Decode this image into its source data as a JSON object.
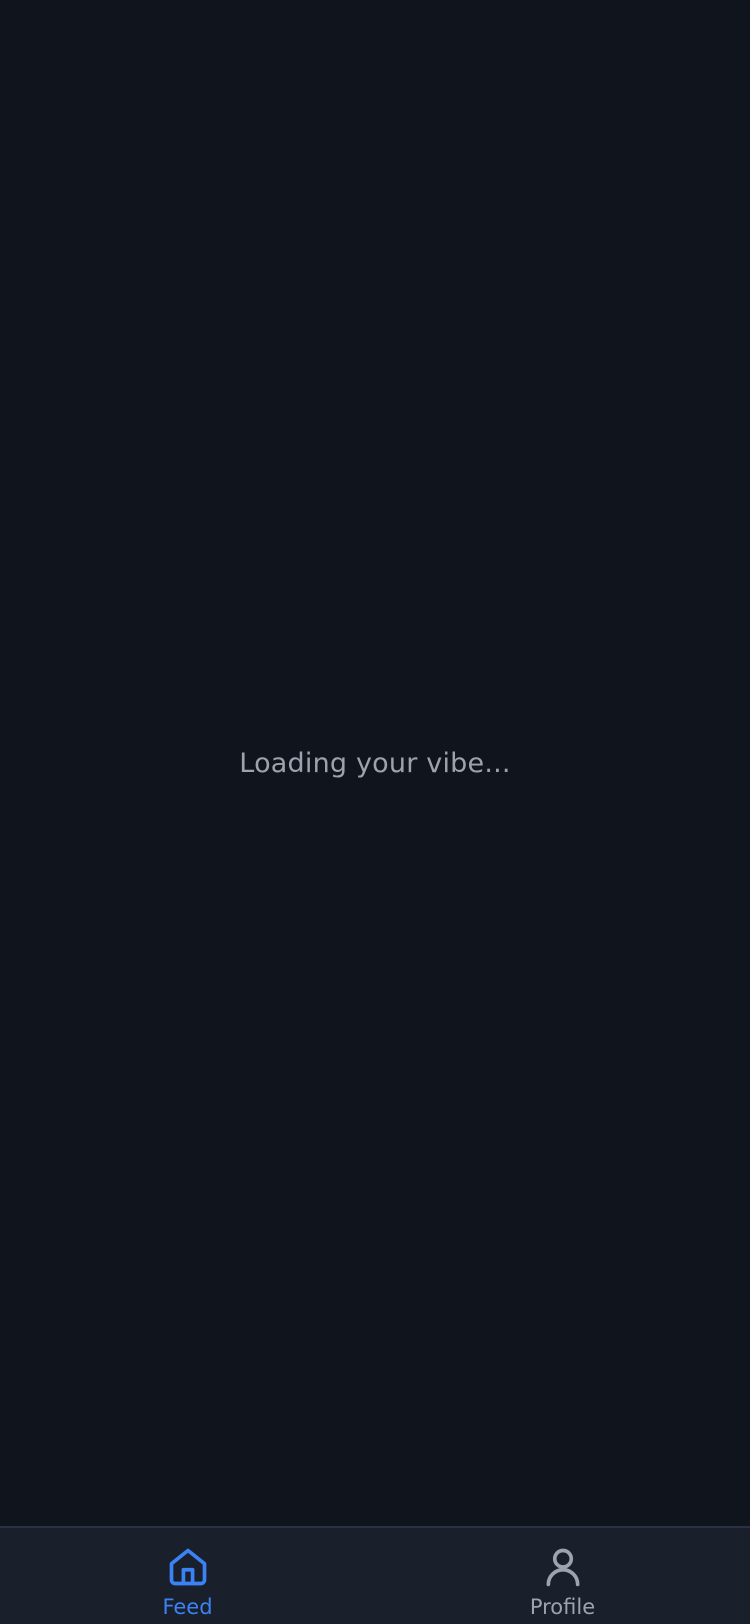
{
  "status": {
    "loading_message": "Loading your vibe..."
  },
  "tabbar": {
    "tabs": [
      {
        "id": "feed",
        "label": "Feed",
        "icon": "home-icon",
        "active": true
      },
      {
        "id": "profile",
        "label": "Profile",
        "icon": "user-icon",
        "active": false
      }
    ]
  },
  "colors": {
    "background": "#10141c",
    "tabbar_background": "#1a202b",
    "accent": "#3b82f6",
    "muted_text": "#9ca3af"
  }
}
